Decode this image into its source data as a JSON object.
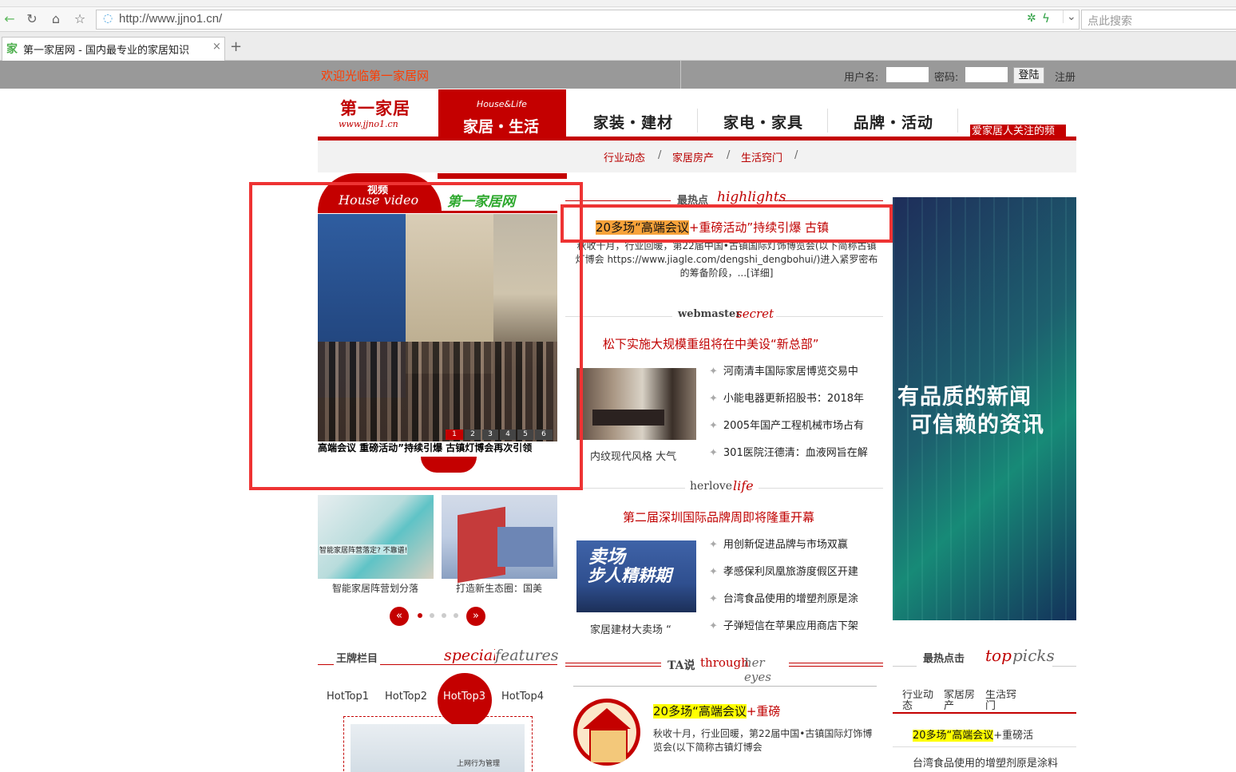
{
  "browser": {
    "url": "http://www.jjno1.cn/",
    "search_placeholder": "点此搜索",
    "tab_title": "第一家居网 - 国内最专业的家居知识",
    "tab_favicon": "家",
    "new_tab": "+",
    "close_tab": "×"
  },
  "topbar": {
    "welcome": "欢迎光临第一家居网",
    "username_label": "用户名:",
    "password_label": "密码:",
    "login_button": "登陆",
    "register_link": "注册"
  },
  "logo": {
    "title": "第一家居",
    "url": "www.jjno1.cn"
  },
  "nav": {
    "active_sub": "House&Life",
    "active": "家居・生活",
    "items": [
      "家装・建材",
      "家电・家具",
      "品牌・活动"
    ],
    "badge": "爱家居人关注的频"
  },
  "subnav": {
    "items": [
      "行业动态",
      "家居房产",
      "生活窍门"
    ],
    "sep": "/"
  },
  "video": {
    "title_cn": "视频",
    "title_en": "House video",
    "site_tag": "第一家居网",
    "caption": "高端会议 重磅活动”持续引爆 古镇灯博会再次引领",
    "pages": [
      "1",
      "2",
      "3",
      "4",
      "5",
      "6"
    ]
  },
  "thumbs": [
    {
      "overlay": "智能家居阵营落定? 不靠谱!",
      "caption": "智能家居阵营划分落"
    },
    {
      "caption": "打造新生态圈：国美"
    }
  ],
  "highlights": {
    "title_cn": "最热点",
    "title_en": "highlights",
    "headline_a": "20多场“高端会议",
    "headline_b": "+重磅活动”持续引爆 古镇",
    "summary": "秋收十月，行业回暖，第22届中国•古镇国际灯饰博览会(以下简称古镇灯博会 https://www.jiagle.com/dengshi_dengbohui/)进入紧罗密布的筹备阶段，...[详细]"
  },
  "webmaster": {
    "title_a": "webmaster",
    "title_b": "secret",
    "headline": "松下实施大规模重组将在中美设“新总部”",
    "image_caption": "内纹现代风格 大气",
    "items": [
      "河南清丰国际家居博览交易中",
      "小能电器更新招股书：2018年",
      "2005年国产工程机械市场占有",
      "301医院汪德清：血液网旨在解"
    ]
  },
  "herlove": {
    "title_a": "herlove",
    "title_b": "life",
    "headline": "第二届深圳国际品牌周即将隆重开幕",
    "image_text_1": "卖场",
    "image_text_2": "步人精耕期",
    "image_caption": "家居建材大卖场 “",
    "items": [
      "用创新促进品牌与市场双赢",
      "孝感保利凤凰旅游度假区开建",
      "台湾食品使用的增塑剂原是涂",
      "子弹短信在苹果应用商店下架"
    ]
  },
  "ad": {
    "line1": "有品质的新闻",
    "line2": "可信赖的资讯"
  },
  "special": {
    "title_cn": "王牌栏目",
    "title_en_a": "special",
    "title_en_b": "features",
    "tabs": [
      "HotTop1",
      "HotTop2",
      "HotTop3",
      "HotTop4"
    ],
    "image_text": "上网行为管理"
  },
  "ta": {
    "title_a": "TA说",
    "title_b": "through",
    "title_c": "her eyes",
    "headline_a": "20多场“高端会议",
    "headline_b": "+重磅",
    "summary": "秋收十月，行业回暖，第22届中国•古镇国际灯饰博览会(以下简称古镇灯博会"
  },
  "toppicks": {
    "title_cn": "最热点击",
    "title_en_a": "top",
    "title_en_b": "picks",
    "tabs": [
      "行业动态",
      "家居房产",
      "生活窍门"
    ],
    "item1_a": "20多场“高端会议",
    "item1_b": "+重磅活",
    "item2": "台湾食品使用的增塑剂原是涂料"
  },
  "colors": {
    "brand_red": "#c00000",
    "annotation_red": "#ee3333",
    "topbar_gray": "#999999"
  }
}
